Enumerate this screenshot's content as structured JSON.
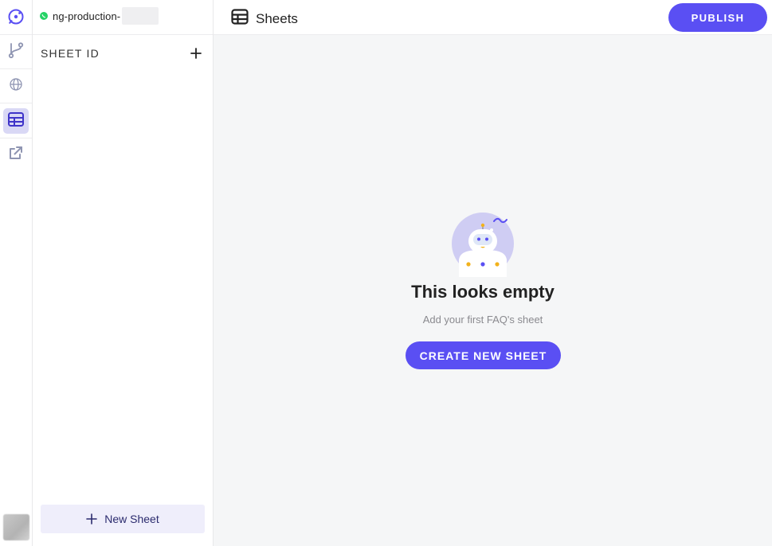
{
  "project": {
    "name": "ng-production-",
    "channel_icon": "whatsapp-icon"
  },
  "rail": {
    "items": [
      {
        "name": "flows",
        "icon": "git-branch-icon"
      },
      {
        "name": "web",
        "icon": "globe-icon"
      },
      {
        "name": "sheets",
        "icon": "table-icon",
        "active": true
      },
      {
        "name": "integrations",
        "icon": "external-link-icon"
      }
    ]
  },
  "sidebar": {
    "header": "SHEET ID",
    "new_sheet_label": "New Sheet"
  },
  "header": {
    "title": "Sheets",
    "publish_label": "PUBLISH"
  },
  "empty_state": {
    "title": "This looks empty",
    "subtitle": "Add your first FAQ's sheet",
    "cta_label": "CREATE NEW SHEET"
  },
  "colors": {
    "accent": "#5a4ff3",
    "accent_light": "#efeefb",
    "rail_active": "#d9d8f5",
    "main_bg": "#f5f6f7",
    "whatsapp": "#25d366"
  }
}
